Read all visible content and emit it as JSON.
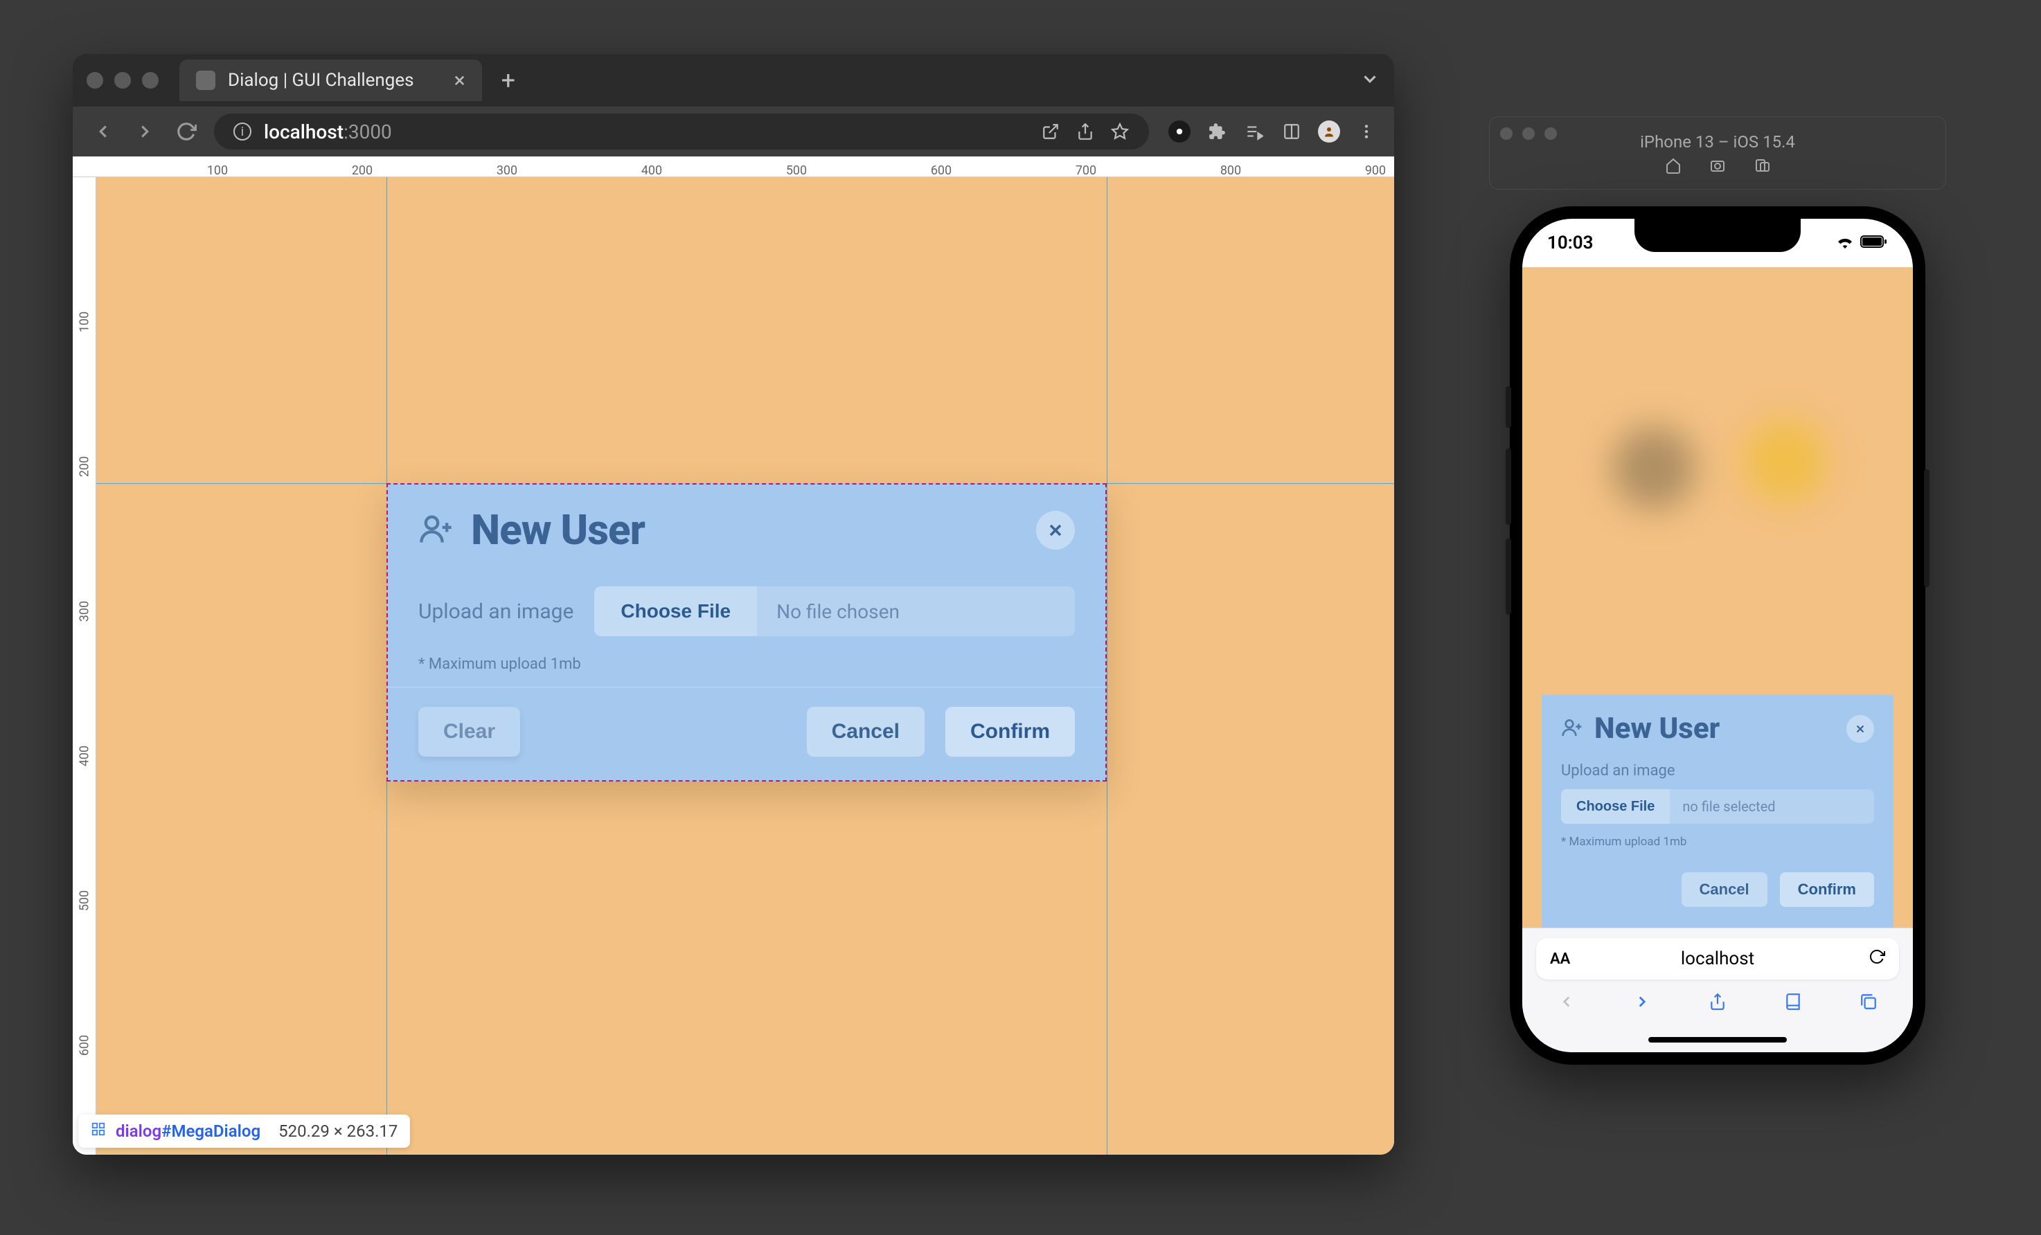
{
  "browser": {
    "tab_title": "Dialog | GUI Challenges",
    "url_host": "localhost",
    "url_port": ":3000",
    "rulers": {
      "horizontal": [
        "100",
        "200",
        "300",
        "400",
        "500",
        "600",
        "700",
        "800",
        "900"
      ],
      "vertical": [
        "100",
        "200",
        "300",
        "400",
        "500",
        "600"
      ]
    }
  },
  "dialog": {
    "title": "New User",
    "upload_label": "Upload an image",
    "choose_file": "Choose File",
    "no_file": "No file chosen",
    "hint": "* Maximum upload 1mb",
    "clear": "Clear",
    "cancel": "Cancel",
    "confirm": "Confirm"
  },
  "inspect": {
    "selector_tag": "dialog",
    "selector_id": "#MegaDialog",
    "dimensions": "520.29 × 263.17"
  },
  "simulator": {
    "title": "iPhone 13 – iOS 15.4",
    "status_time": "10:03",
    "safari_url": "localhost",
    "aa": "AA"
  },
  "mobile_dialog": {
    "title": "New User",
    "upload_label": "Upload an image",
    "choose_file": "Choose File",
    "no_file": "no file selected",
    "hint": "* Maximum upload 1mb",
    "cancel": "Cancel",
    "confirm": "Confirm"
  }
}
